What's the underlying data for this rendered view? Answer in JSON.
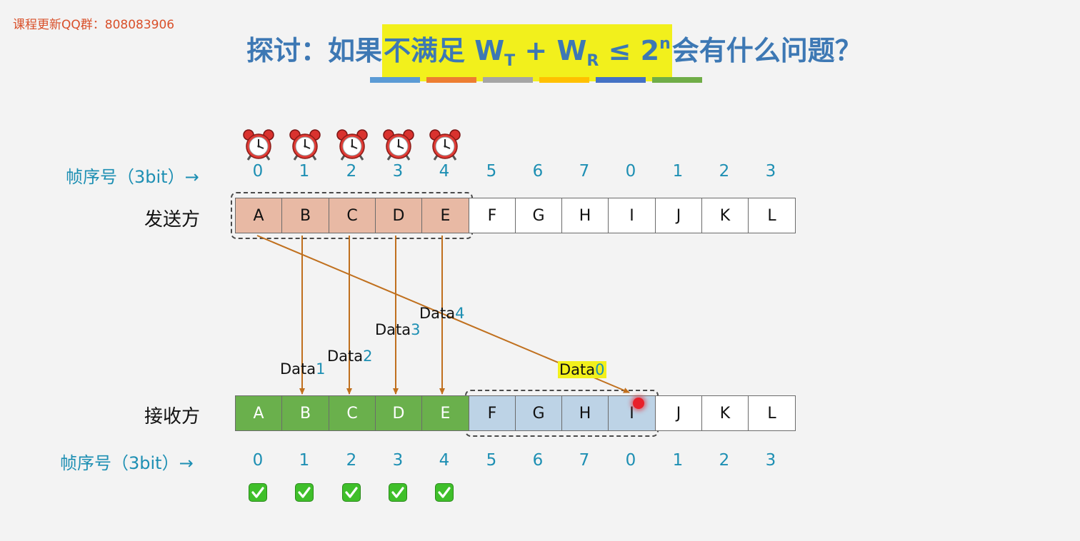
{
  "watermark": "课程更新QQ群：808083906",
  "title": {
    "prefix": "探讨：如果",
    "highlight_a": "不满足 W",
    "sub_t": "T",
    "mid": " + W",
    "sub_r": "R",
    "leq": " ≤ 2",
    "sup_n": "n",
    "suffix": "会有什么问题？"
  },
  "bar_colors": [
    "#5b9bd5",
    "#ed7d31",
    "#a5a5a5",
    "#ffc000",
    "#4472c4",
    "#70ad47"
  ],
  "sender": {
    "label": "发送方",
    "seq_label": "帧序号（3bit）→",
    "seq": [
      "0",
      "1",
      "2",
      "3",
      "4",
      "5",
      "6",
      "7",
      "0",
      "1",
      "2",
      "3"
    ],
    "frames": [
      "A",
      "B",
      "C",
      "D",
      "E",
      "F",
      "G",
      "H",
      "I",
      "J",
      "K",
      "L"
    ],
    "window_size": 5,
    "clock_count": 5
  },
  "receiver": {
    "label": "接收方",
    "seq_label": "帧序号（3bit）→",
    "seq": [
      "0",
      "1",
      "2",
      "3",
      "4",
      "5",
      "6",
      "7",
      "0",
      "1",
      "2",
      "3"
    ],
    "frames": [
      "A",
      "B",
      "C",
      "D",
      "E",
      "F",
      "G",
      "H",
      "I",
      "J",
      "K",
      "L"
    ],
    "received_count": 5,
    "window_start": 5,
    "window_size": 4,
    "check_count": 5
  },
  "colors": {
    "sender_window_fill": "#e8b9a4",
    "received_fill": "#6ab04c",
    "receiver_window_fill": "#bdd3e6",
    "arrow": "#c0701e"
  },
  "data_labels": [
    {
      "prefix": "Data",
      "num": "1"
    },
    {
      "prefix": "Data",
      "num": "2"
    },
    {
      "prefix": "Data",
      "num": "3"
    },
    {
      "prefix": "Data",
      "num": "4"
    },
    {
      "prefix": "Data",
      "num": "0"
    }
  ]
}
